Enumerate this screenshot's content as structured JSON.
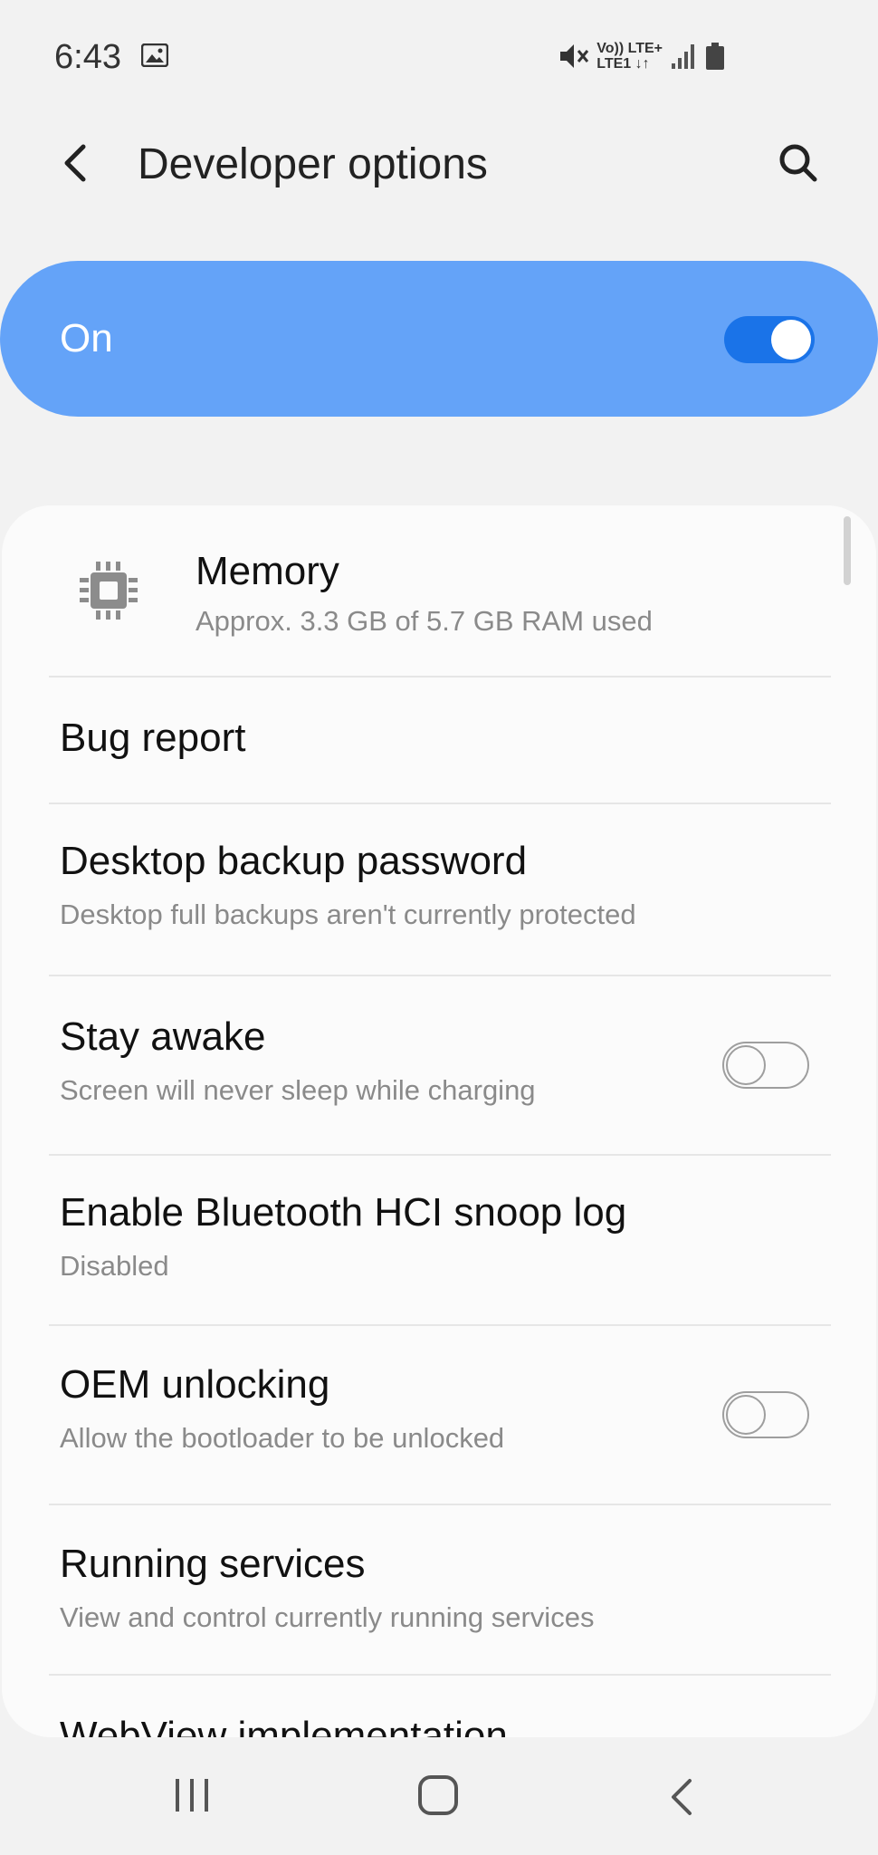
{
  "status_bar": {
    "time": "6:43",
    "network_top": "Vo)) LTE+",
    "network_bottom": "LTE1 ↓↑",
    "icons": [
      "gallery-icon",
      "mute-icon",
      "signal-icon",
      "battery-icon"
    ]
  },
  "header": {
    "title": "Developer options",
    "back_icon": "back-arrow-icon",
    "search_icon": "search-icon"
  },
  "master_switch": {
    "label": "On",
    "enabled": true,
    "color": "#64a3f8"
  },
  "settings": [
    {
      "title": "Memory",
      "subtitle": "Approx. 3.3 GB of 5.7 GB RAM used",
      "icon": "chip-icon"
    },
    {
      "title": "Bug report"
    },
    {
      "title": "Desktop backup password",
      "subtitle": "Desktop full backups aren't currently protected"
    },
    {
      "title": "Stay awake",
      "subtitle": "Screen will never sleep while charging",
      "toggle": false
    },
    {
      "title": "Enable Bluetooth HCI snoop log",
      "subtitle": "Disabled"
    },
    {
      "title": "OEM unlocking",
      "subtitle": "Allow the bootloader to be unlocked",
      "toggle": false
    },
    {
      "title": "Running services",
      "subtitle": "View and control currently running services"
    },
    {
      "title": "WebView implementation"
    }
  ],
  "nav_bar": {
    "icons": [
      "recents-icon",
      "home-icon",
      "back-icon"
    ]
  }
}
